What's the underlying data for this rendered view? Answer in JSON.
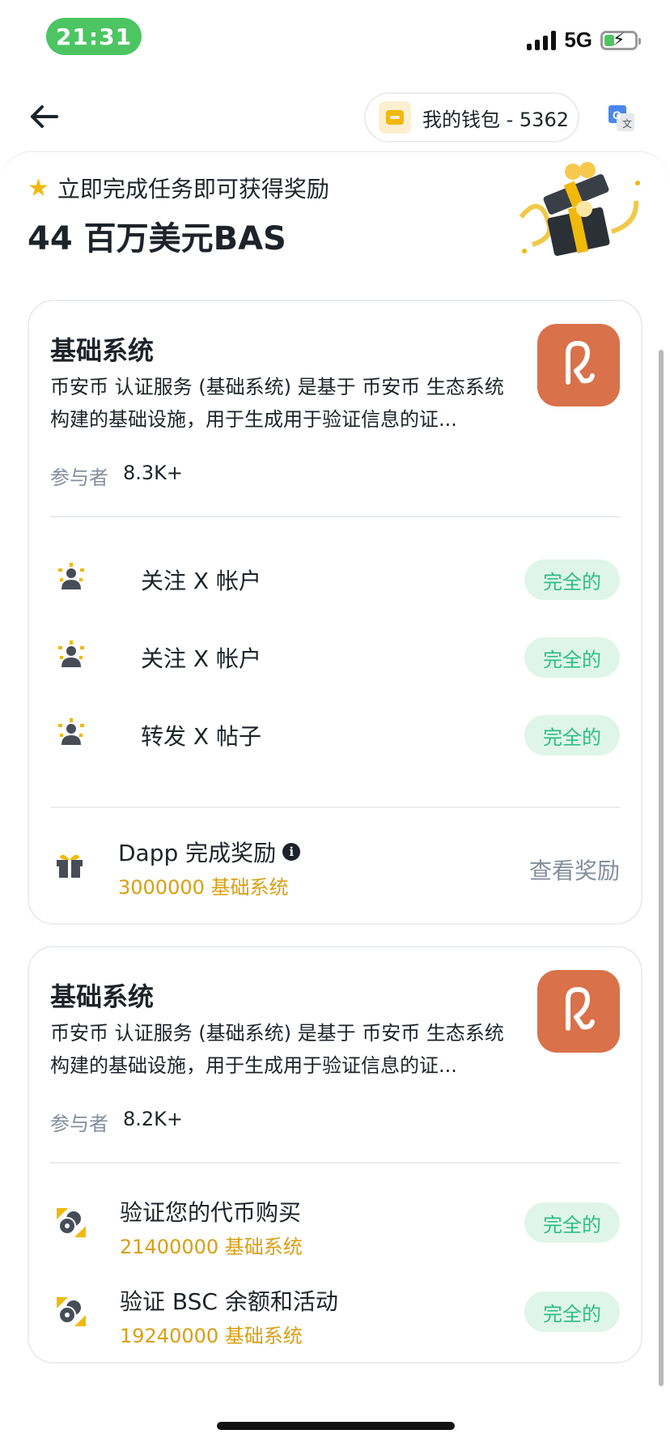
{
  "status_bar": {
    "time": "21:31",
    "network": "5G"
  },
  "header": {
    "wallet_label": "我的钱包 - 5362"
  },
  "hero": {
    "subtitle": "立即完成任务即可获得奖励",
    "title": "44 百万美元BAS"
  },
  "cards": [
    {
      "title": "基础系统",
      "description": "币安币 认证服务 (基础系统) 是基于 币安币 生态系统构建的基础设施，用于生成用于验证信息的证...",
      "participants_label": "参与者",
      "participants_count": "8.3K+",
      "tasks": [
        {
          "label": "关注 X 帐户",
          "status": "完全的"
        },
        {
          "label": "关注 X 帐户",
          "status": "完全的"
        },
        {
          "label": "转发 X 帖子",
          "status": "完全的"
        }
      ],
      "reward": {
        "title": "Dapp 完成奖励",
        "amount": "3000000 基础系统",
        "action": "查看奖励"
      }
    },
    {
      "title": "基础系统",
      "description": "币安币 认证服务 (基础系统) 是基于 币安币 生态系统构建的基础设施，用于生成用于验证信息的证...",
      "participants_label": "参与者",
      "participants_count": "8.2K+",
      "tasks": [
        {
          "label": "验证您的代币购买",
          "amount": "21400000 基础系统",
          "status": "完全的"
        },
        {
          "label": "验证 BSC 余额和活动",
          "amount": "19240000 基础系统",
          "status": "完全的"
        }
      ]
    }
  ],
  "icons": {
    "back": "arrow-left-icon",
    "wallet": "wallet-icon",
    "translate": "translate-icon",
    "star": "star-icon",
    "follow": "user-follow-icon",
    "gift": "gift-icon",
    "info": "info-icon",
    "verify": "coins-verify-icon"
  },
  "colors": {
    "brand_yellow": "#f0b90b",
    "success_text": "#2ebd85",
    "success_bg": "#dff5ea",
    "logo_bg": "#d9714a",
    "amount_text": "#d89f11"
  }
}
